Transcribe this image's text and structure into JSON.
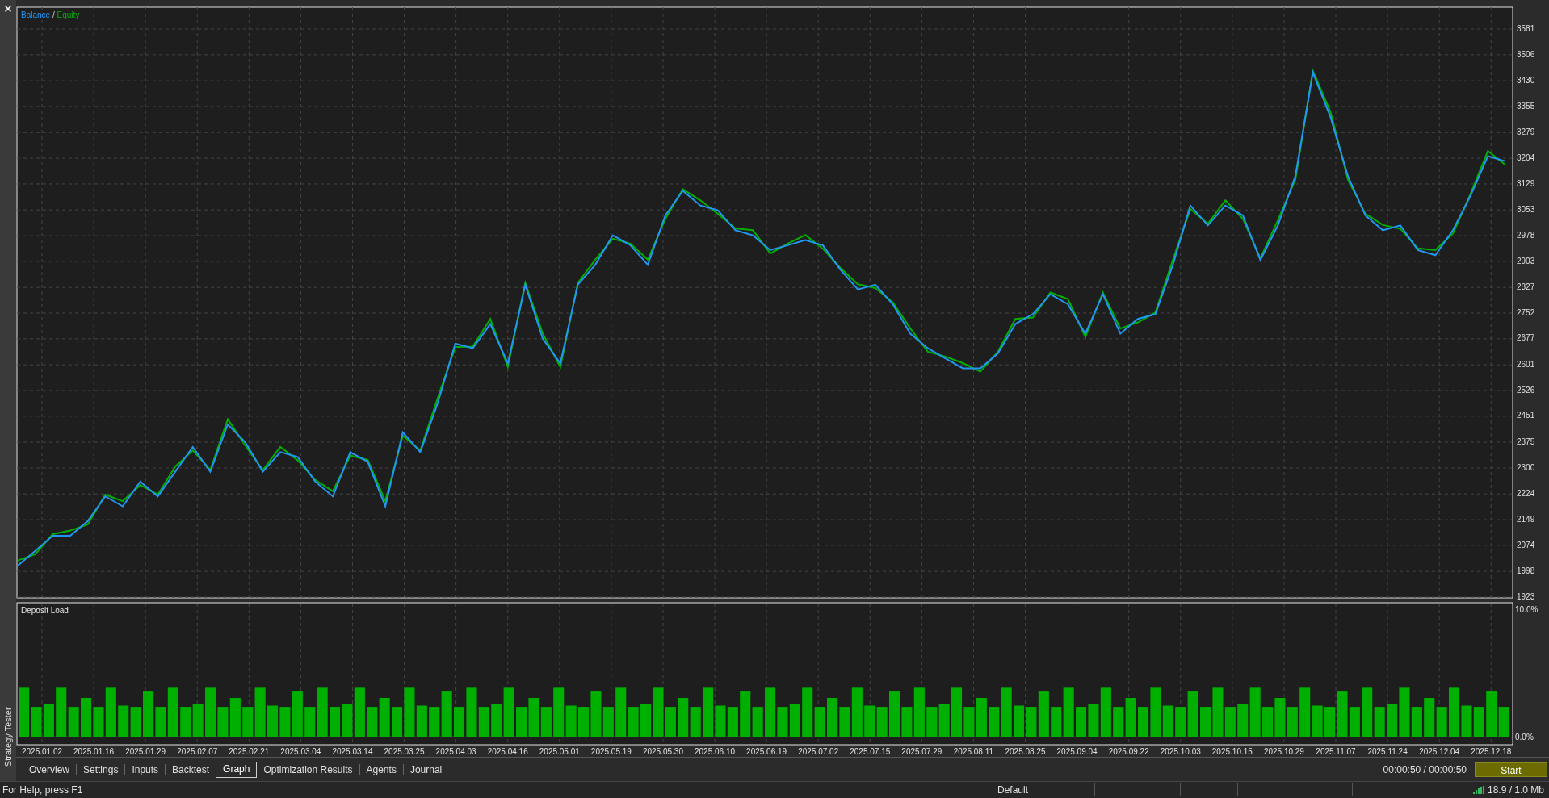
{
  "side_panel": {
    "title": "Strategy Tester"
  },
  "graph": {
    "legend_separator": "/",
    "chart_data": {
      "type": "line",
      "grid": true,
      "ylim": [
        1923,
        3647
      ],
      "yticks": [
        1923,
        1998,
        2074,
        2149,
        2224,
        2300,
        2375,
        2451,
        2526,
        2601,
        2677,
        2752,
        2827,
        2903,
        2978,
        3053,
        3129,
        3204,
        3279,
        3355,
        3430,
        3506,
        3581
      ],
      "categories": [
        null,
        null,
        null,
        null,
        null,
        null,
        null,
        null,
        null,
        null,
        null,
        null,
        null,
        null,
        null,
        null,
        null,
        null,
        null,
        null,
        null,
        null,
        null,
        null,
        null,
        null,
        null,
        null,
        null,
        null,
        null,
        null,
        null,
        null,
        null,
        null,
        null,
        null,
        null,
        null,
        null,
        null,
        null,
        null,
        null,
        null,
        null,
        null,
        null,
        null,
        null,
        null,
        null,
        null,
        null,
        null,
        null,
        null,
        null,
        null,
        null,
        null,
        null,
        null,
        null,
        null,
        null,
        null,
        null,
        null,
        null,
        null,
        null,
        null,
        null,
        null,
        null,
        null,
        null,
        null,
        null,
        null,
        null,
        null,
        null,
        null
      ],
      "series": [
        {
          "name": "Balance",
          "color": "#2196f3",
          "values": [
            2015,
            2058,
            2102,
            2102,
            2145,
            2217,
            2188,
            2260,
            2217,
            2289,
            2361,
            2289,
            2427,
            2375,
            2289,
            2346,
            2332,
            2260,
            2217,
            2346,
            2318,
            2188,
            2404,
            2346,
            2490,
            2663,
            2649,
            2720,
            2605,
            2835,
            2677,
            2605,
            2835,
            2893,
            2979,
            2950,
            2893,
            3037,
            3109,
            3066,
            3052,
            2994,
            2979,
            2936,
            2950,
            2965,
            2950,
            2879,
            2821,
            2835,
            2778,
            2692,
            2649,
            2620,
            2591,
            2591,
            2634,
            2720,
            2749,
            2807,
            2778,
            2692,
            2807,
            2692,
            2735,
            2749,
            2893,
            3066,
            3008,
            3066,
            3037,
            2907,
            3008,
            3152,
            3454,
            3325,
            3152,
            3037,
            2994,
            3008,
            2936,
            2921,
            2994,
            3094,
            3210,
            3195
          ]
        },
        {
          "name": "Equity",
          "color": "#00b000",
          "values": [
            2030,
            2048,
            2107,
            2117,
            2135,
            2222,
            2203,
            2250,
            2222,
            2304,
            2351,
            2294,
            2442,
            2365,
            2294,
            2361,
            2322,
            2265,
            2232,
            2336,
            2323,
            2203,
            2394,
            2351,
            2505,
            2653,
            2654,
            2735,
            2595,
            2840,
            2692,
            2595,
            2840,
            2908,
            2969,
            2955,
            2908,
            3027,
            3114,
            3081,
            3042,
            2999,
            2994,
            2926,
            2955,
            2980,
            2940,
            2884,
            2836,
            2825,
            2783,
            2707,
            2639,
            2625,
            2606,
            2581,
            2639,
            2735,
            2739,
            2812,
            2793,
            2682,
            2812,
            2707,
            2725,
            2754,
            2908,
            3056,
            3013,
            3081,
            3027,
            2912,
            3023,
            3142,
            3459,
            3340,
            3142,
            3042,
            3009,
            2998,
            2941,
            2936,
            2984,
            3099,
            3225,
            3185
          ]
        }
      ]
    }
  },
  "deposit_load": {
    "chart_data": {
      "type": "bar",
      "grid": true,
      "ylim": [
        0,
        10.5
      ],
      "yticks": [
        {
          "value": 0,
          "label": "0.0%"
        },
        {
          "value": 10,
          "label": "10.0%"
        }
      ],
      "categories": [
        null,
        null,
        null,
        null,
        null,
        null,
        null,
        null,
        null,
        null,
        null,
        null,
        null,
        null,
        null,
        null,
        null,
        null,
        null,
        null,
        null,
        null,
        null,
        null,
        null,
        null,
        null,
        null,
        null,
        null,
        null,
        null,
        null,
        null,
        null,
        null,
        null,
        null,
        null,
        null,
        null,
        null,
        null,
        null,
        null,
        null,
        null,
        null,
        null,
        null,
        null,
        null,
        null,
        null,
        null,
        null,
        null,
        null,
        null,
        null,
        null,
        null,
        null,
        null,
        null,
        null,
        null,
        null,
        null,
        null,
        null,
        null,
        null,
        null,
        null,
        null,
        null,
        null,
        null,
        null,
        null,
        null,
        null,
        null,
        null,
        null,
        null,
        null,
        null,
        null,
        null,
        null,
        null,
        null,
        null,
        null,
        null,
        null,
        null,
        null,
        null,
        null,
        null,
        null,
        null,
        null,
        null,
        null,
        null,
        null,
        null,
        null,
        null,
        null,
        null,
        null,
        null,
        null,
        null,
        null
      ],
      "series": [
        {
          "name": "Deposit Load",
          "color": "#00b000",
          "values": [
            3.9,
            2.4,
            2.6,
            3.9,
            2.4,
            3.1,
            2.4,
            3.9,
            2.5,
            2.4,
            3.6,
            2.4,
            3.9,
            2.4,
            2.6,
            3.9,
            2.4,
            3.1,
            2.4,
            3.9,
            2.5,
            2.4,
            3.6,
            2.4,
            3.9,
            2.4,
            2.6,
            3.9,
            2.4,
            3.1,
            2.4,
            3.9,
            2.5,
            2.4,
            3.6,
            2.4,
            3.9,
            2.4,
            2.6,
            3.9,
            2.4,
            3.1,
            2.4,
            3.9,
            2.5,
            2.4,
            3.6,
            2.4,
            3.9,
            2.4,
            2.6,
            3.9,
            2.4,
            3.1,
            2.4,
            3.9,
            2.5,
            2.4,
            3.6,
            2.4,
            3.9,
            2.4,
            2.6,
            3.9,
            2.4,
            3.1,
            2.4,
            3.9,
            2.5,
            2.4,
            3.6,
            2.4,
            3.9,
            2.4,
            2.6,
            3.9,
            2.4,
            3.1,
            2.4,
            3.9,
            2.5,
            2.4,
            3.6,
            2.4,
            3.9,
            2.4,
            2.6,
            3.9,
            2.4,
            3.1,
            2.4,
            3.9,
            2.5,
            2.4,
            3.6,
            2.4,
            3.9,
            2.4,
            2.6,
            3.9,
            2.4,
            3.1,
            2.4,
            3.9,
            2.5,
            2.4,
            3.6,
            2.4,
            3.9,
            2.4,
            2.6,
            3.9,
            2.4,
            3.1,
            2.4,
            3.9,
            2.5,
            2.4,
            3.6,
            2.4
          ]
        }
      ]
    }
  },
  "date_axis": {
    "labels": [
      "2025.01.02",
      "2025.01.16",
      "2025.01.29",
      "2025.02.07",
      "2025.02.21",
      "2025.03.04",
      "2025.03.14",
      "2025.03.25",
      "2025.04.03",
      "2025.04.16",
      "2025.05.01",
      "2025.05.19",
      "2025.05.30",
      "2025.06.10",
      "2025.06.19",
      "2025.07.02",
      "2025.07.15",
      "2025.07.29",
      "2025.08.11",
      "2025.08.25",
      "2025.09.04",
      "2025.09.22",
      "2025.10.03",
      "2025.10.15",
      "2025.10.29",
      "2025.11.07",
      "2025.11.24",
      "2025.12.04",
      "2025.12.18"
    ]
  },
  "tabs": [
    {
      "label": "Overview",
      "selected": false
    },
    {
      "label": "Settings",
      "selected": false
    },
    {
      "label": "Inputs",
      "selected": false
    },
    {
      "label": "Backtest",
      "selected": false
    },
    {
      "label": "Graph",
      "selected": true
    },
    {
      "label": "Optimization Results",
      "selected": false
    },
    {
      "label": "Agents",
      "selected": false
    },
    {
      "label": "Journal",
      "selected": false
    }
  ],
  "progress": {
    "time": "00:00:50 / 00:00:50",
    "button": "Start"
  },
  "status_bar": {
    "help": "For Help, press F1",
    "profile": "Default",
    "traffic": "18.9 / 1.0 Mb"
  }
}
